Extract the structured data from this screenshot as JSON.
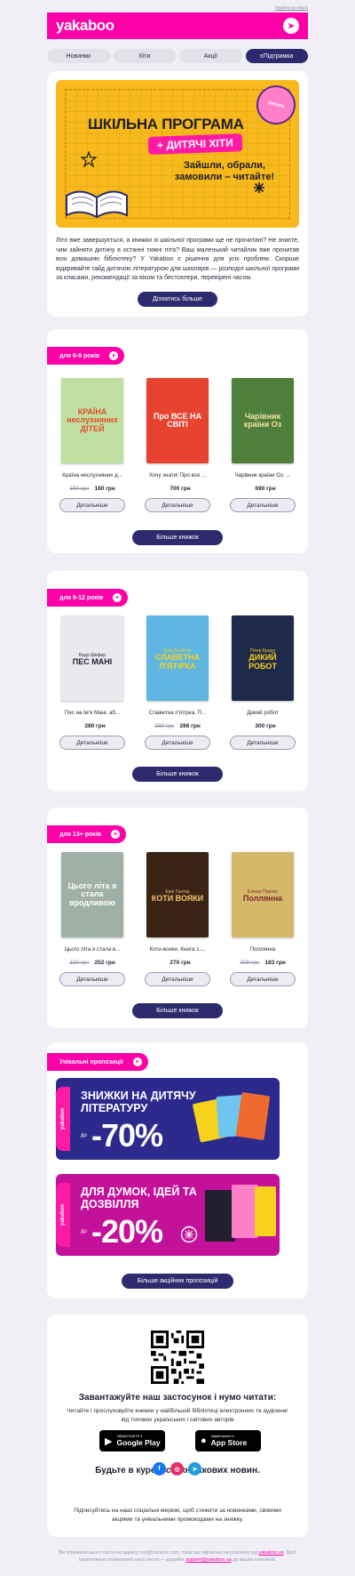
{
  "top_link": "Перейти до версії",
  "header": {
    "logo": "yakaboo",
    "icon": "send-plane-icon"
  },
  "nav": {
    "tabs": [
      "Новинки",
      "Хіти",
      "Акції",
      "єПідтримка"
    ],
    "active": "єПідтримка"
  },
  "hero": {
    "title": "ШКІЛЬНА ПРОГРАМА",
    "pill": "+ ДИТЯЧІ ХІТИ",
    "subtitle": "Зайшли, обрали, замовили – читайте!",
    "lollipop_label": "школа",
    "text": "Літо вже завершується, а книжки зі шкільної програми ще не прочитані? Не знаєте, чим зайняти дитину в останні тижні літа? Ваш маленький читайлик вже прочитав всю домашню бібліотеку? У Yakaboo є рішення для усіх проблем. Скоріше відкривайте гайд дитячою літературою для школярів — розподіл шкільної програми за класами, рекомендації за віком та бестселери, перевірені часом.",
    "button": "Дізнатись більше"
  },
  "sections": [
    {
      "label": "для 6-8 років",
      "more_button": "Більше книжок",
      "books": [
        {
          "name": "Країна неслухняних д...",
          "old_price": "190 грн",
          "price": "180 грн",
          "cover_title": "КРАЇНА неслухняних ДІТЕЙ",
          "cover_sub": "",
          "cover_bg": "#bfe0a0",
          "cover_fg": "#e24a2a",
          "button": "Детальніше"
        },
        {
          "name": "Хочу знати! Про все ...",
          "old_price": "",
          "price": "700 грн",
          "cover_title": "Про ВСЕ НА СВІТІ",
          "cover_sub": "",
          "cover_bg": "#e8432f",
          "cover_fg": "#ffffff",
          "button": "Детальніше"
        },
        {
          "name": "Чарівник країни Оз. ...",
          "old_price": "",
          "price": "690 грн",
          "cover_title": "Чарівник країни Оз",
          "cover_sub": "",
          "cover_bg": "#4f7f3a",
          "cover_fg": "#f3e3a3",
          "button": "Детальніше"
        }
      ]
    },
    {
      "label": "для 9-12 років",
      "more_button": "Більше книжок",
      "books": [
        {
          "name": "Пес на ім'я Мані, аб...",
          "old_price": "",
          "price": "280 грн",
          "cover_title": "ПЕС МАНІ",
          "cover_sub": "Бодо Шефер",
          "cover_bg": "#e9e9ef",
          "cover_fg": "#1f1f2e",
          "button": "Детальніше"
        },
        {
          "name": "Славетна п'ятірка. П...",
          "old_price": "280 грн",
          "price": "266 грн",
          "cover_title": "СЛАВЕТНА П'ЯТІРКА",
          "cover_sub": "Енід Блайтон",
          "cover_bg": "#5fb6e0",
          "cover_fg": "#f7d21c",
          "button": "Детальніше"
        },
        {
          "name": "Дикий робот",
          "old_price": "",
          "price": "300 грн",
          "cover_title": "ДИКИЙ РОБОТ",
          "cover_sub": "Пітер Браун",
          "cover_bg": "#1e2a4a",
          "cover_fg": "#f7d21c",
          "button": "Детальніше"
        }
      ]
    },
    {
      "label": "для 13+ років",
      "more_button": "Більше книжок",
      "books": [
        {
          "name": "Цього літа я стала в...",
          "old_price": "320 грн",
          "price": "252 грн",
          "cover_title": "Цього літа я стала вродливою",
          "cover_sub": "",
          "cover_bg": "#9fb0a6",
          "cover_fg": "#ffffff",
          "button": "Детальніше"
        },
        {
          "name": "Коти-вояки. Книга 1....",
          "old_price": "",
          "price": "270 грн",
          "cover_title": "КОТИ ВОЯКИ",
          "cover_sub": "Ерін Гантер",
          "cover_bg": "#3a2416",
          "cover_fg": "#f0c36b",
          "button": "Детальніше"
        },
        {
          "name": "Поллянна",
          "old_price": "209 грн",
          "price": "183 грн",
          "cover_title": "Поллянна",
          "cover_sub": "Елінор Портер",
          "cover_bg": "#d6b86a",
          "cover_fg": "#7a2a2a",
          "button": "Детальніше"
        }
      ]
    }
  ],
  "promos": {
    "label": "Унікальні пропозиції",
    "banner1": {
      "side": "yakaboo",
      "head": "ЗНИЖКИ НА ДИТЯЧУ ЛІТЕРАТУРУ",
      "small": "до",
      "big": "-70%",
      "bg": "#2d2a8e"
    },
    "banner2": {
      "side": "yakaboo",
      "head": "ДЛЯ ДУМОК, ІДЕЙ ТА ДОЗВІЛЛЯ",
      "small": "до",
      "big": "-20%",
      "bg": "#c4119a"
    },
    "button": "Більше акційних пропозицій"
  },
  "app": {
    "title": "Завантажуйте наш застосунок і нумо читати:",
    "text": "Читайте і прослуховуйте книжки у найбільшій бібліотеці електронних та аудіокниг від топових українських і світових авторів",
    "google_small": "ЗАВАНТАЖТЕ З",
    "google_big": "Google Play",
    "apple_small": "Завантажити в",
    "apple_big": "App Store",
    "news_title": "Будьте в курсі всіх книжкових новин.",
    "news_text": "Підписуйтесь на наші соціальні мережі, щоб стежити за новинками, свіжими акціями та унікальними промокодами на знижку.",
    "socials": [
      "facebook-icon",
      "instagram-icon",
      "telegram-icon"
    ]
  },
  "footer": {
    "line1": "Ви отримали цього листа на адресу xxx@xxxxxxx.com, тому що підписані на розсилку від",
    "link1": "yakaboo.ua",
    "line2": ". Щоб гарантовано отримувати наші листи — додайте",
    "link2": "support@yakaboo.ua",
    "line3": "до ваших контактів."
  }
}
